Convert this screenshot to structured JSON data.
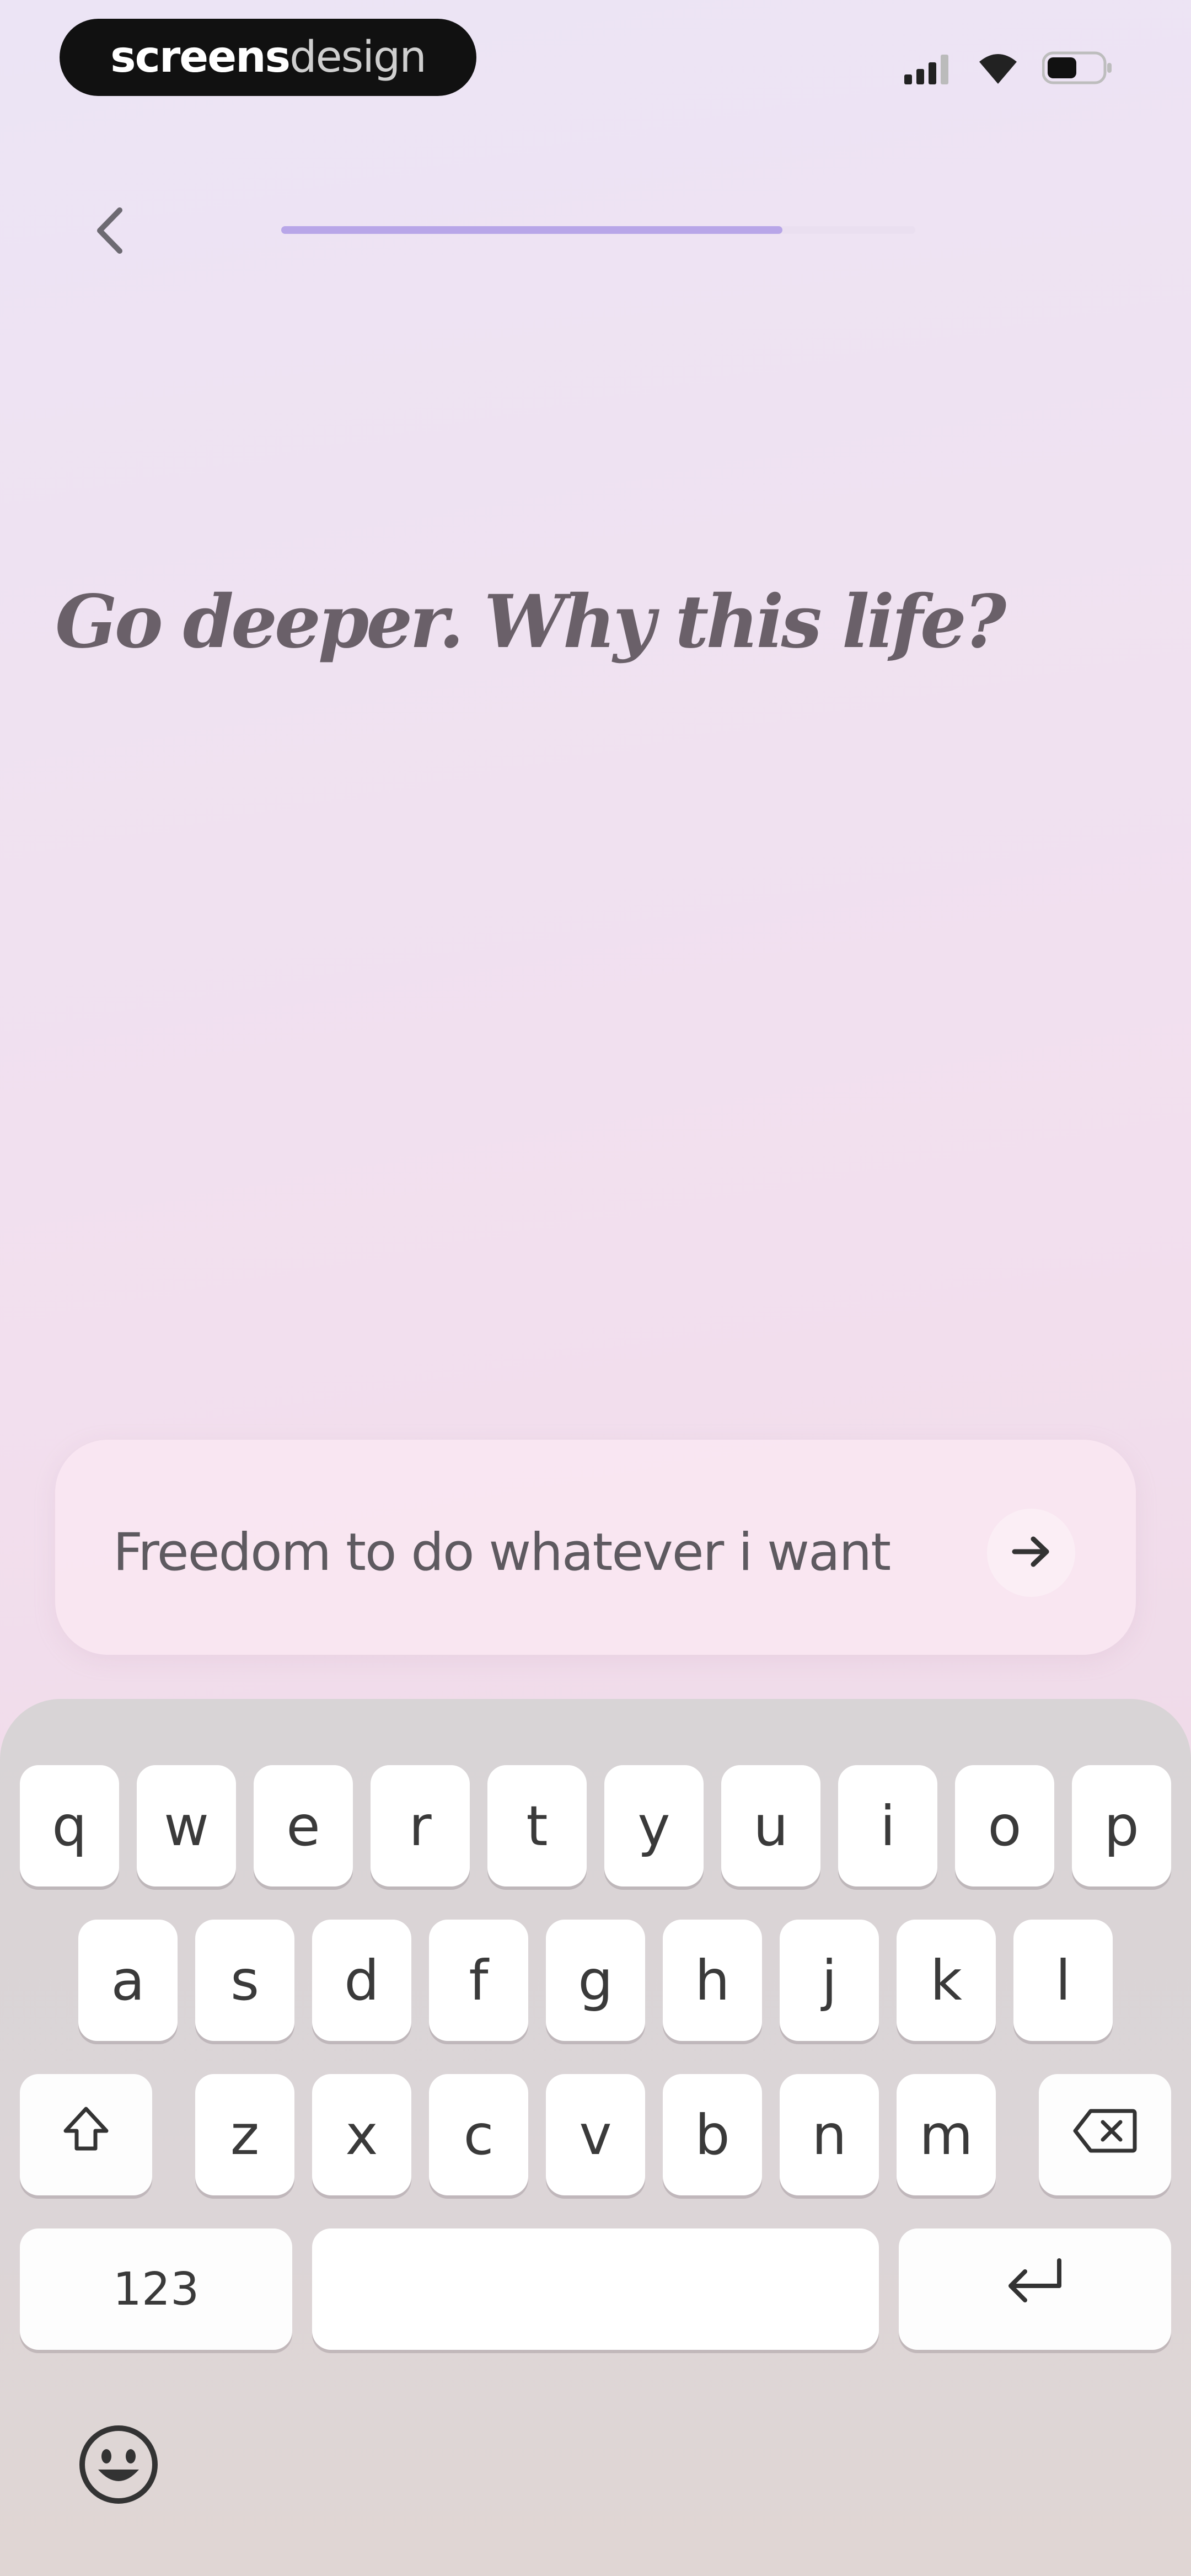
{
  "status_bar": {
    "brand_bold": "screens",
    "brand_light": "design"
  },
  "nav": {
    "back_icon": "chevron-left-icon",
    "progress": 0.79
  },
  "prompt": {
    "question": "Go deeper. Why this life?"
  },
  "input": {
    "value": "Freedom to do whatever i want",
    "send_icon": "arrow-right-icon"
  },
  "keyboard": {
    "row1": [
      "q",
      "w",
      "e",
      "r",
      "t",
      "y",
      "u",
      "i",
      "o",
      "p"
    ],
    "row2": [
      "a",
      "s",
      "d",
      "f",
      "g",
      "h",
      "j",
      "k",
      "l"
    ],
    "row3": [
      "z",
      "x",
      "c",
      "v",
      "b",
      "n",
      "m"
    ],
    "numbers_label": "123",
    "space_hint": "",
    "shift_icon": "shift-icon",
    "delete_icon": "backspace-icon",
    "return_icon": "return-icon",
    "emoji_icon": "emoji-icon"
  },
  "colors": {
    "accent": "#b8a6e8",
    "text": "#6a6069"
  }
}
